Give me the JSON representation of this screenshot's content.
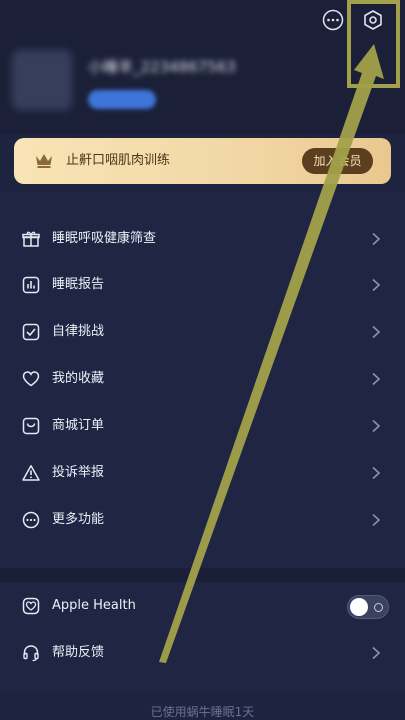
{
  "header": {
    "nickname": "小睡羊_2234867563",
    "more_icon": "ellipsis-circle-icon",
    "settings_icon": "gear-icon"
  },
  "membership": {
    "title": "止鼾口咽肌肉训练",
    "button": "加入会员",
    "icon": "crown-icon",
    "colors": {
      "banner": "#f2d7a5",
      "button": "#5b3f1e"
    }
  },
  "menu": {
    "items": [
      {
        "label": "睡眠呼吸健康筛查",
        "icon": "gift-icon"
      },
      {
        "label": "睡眠报告",
        "icon": "bar-chart-icon"
      },
      {
        "label": "自律挑战",
        "icon": "check-square-icon"
      },
      {
        "label": "我的收藏",
        "icon": "heart-icon"
      },
      {
        "label": "商城订单",
        "icon": "shopping-bag-icon"
      },
      {
        "label": "投诉举报",
        "icon": "warning-triangle-icon"
      },
      {
        "label": "更多功能",
        "icon": "ellipsis-circle-icon"
      }
    ]
  },
  "settings": {
    "apple_health": {
      "label": "Apple Health",
      "icon": "health-heart-icon",
      "enabled": false
    },
    "help": {
      "label": "帮助反馈",
      "icon": "headset-icon"
    }
  },
  "footer": {
    "text": "已使用蜗牛睡眠1天"
  },
  "overlay": {
    "color": "#a2a14a"
  }
}
